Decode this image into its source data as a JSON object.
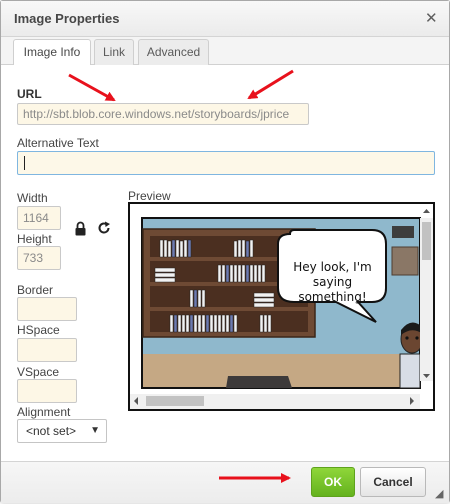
{
  "dialog": {
    "title": "Image Properties",
    "close_icon": "close-icon"
  },
  "tabs": [
    {
      "label": "Image Info",
      "active": true
    },
    {
      "label": "Link",
      "active": false
    },
    {
      "label": "Advanced",
      "active": false
    }
  ],
  "form": {
    "url_label": "URL",
    "url_value": "http://sbt.blob.core.windows.net/storyboards/jprice",
    "alt_label": "Alternative Text",
    "alt_value": "",
    "width_label": "Width",
    "width_value": "1164",
    "height_label": "Height",
    "height_value": "733",
    "lock_icon": "lock-icon",
    "reset_icon": "reset-size-icon",
    "border_label": "Border",
    "border_value": "",
    "hspace_label": "HSpace",
    "hspace_value": "",
    "vspace_label": "VSpace",
    "vspace_value": "",
    "alignment_label": "Alignment",
    "alignment_value": "<not set>",
    "preview_label": "Preview"
  },
  "preview": {
    "speech_text_line1": "Hey look, I'm",
    "speech_text_line2": "saying",
    "speech_text_line3": "something!"
  },
  "footer": {
    "ok_label": "OK",
    "cancel_label": "Cancel"
  },
  "colors": {
    "ok_green": "#64b21e",
    "field_bg": "#fdf7e6",
    "annotation_red": "#e8111c",
    "wall_blue": "#8fb8cc"
  }
}
